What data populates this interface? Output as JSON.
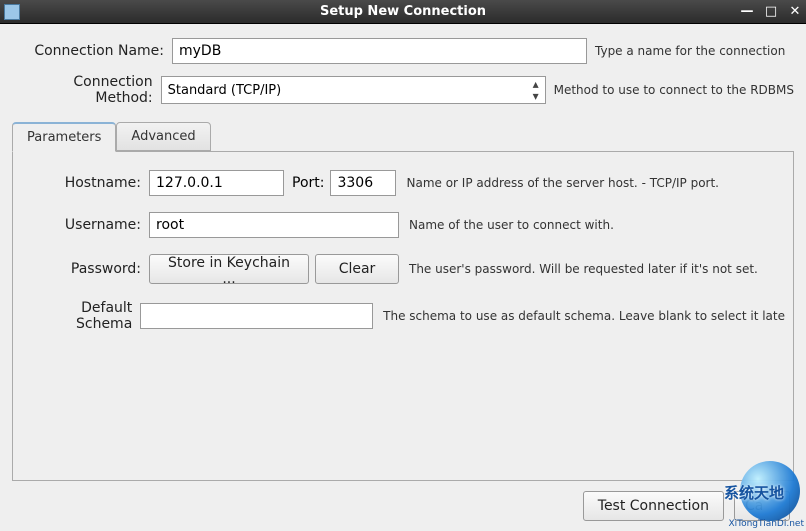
{
  "window": {
    "title": "Setup New Connection"
  },
  "connection_name": {
    "label": "Connection Name:",
    "value": "myDB",
    "hint": "Type a name for the connection"
  },
  "connection_method": {
    "label": "Connection Method:",
    "value": "Standard (TCP/IP)",
    "hint": "Method to use to connect to the RDBMS"
  },
  "tabs": {
    "parameters": "Parameters",
    "advanced": "Advanced"
  },
  "params": {
    "hostname": {
      "label": "Hostname:",
      "value": "127.0.0.1"
    },
    "port": {
      "label": "Port:",
      "value": "3306"
    },
    "host_desc": "Name or IP address of the server host. - TCP/IP port.",
    "username": {
      "label": "Username:",
      "value": "root",
      "desc": "Name of the user to connect with."
    },
    "password": {
      "label": "Password:",
      "store": "Store in Keychain ...",
      "clear": "Clear",
      "desc": "The user's password. Will be requested later if it's not set."
    },
    "schema": {
      "label": "Default Schema",
      "value": "",
      "desc": "The schema to use as default schema. Leave blank to select it late"
    }
  },
  "buttons": {
    "test": "Test Connection",
    "cancel": "Ca"
  },
  "watermark": {
    "main": "系统天地",
    "url": "XiTongTianDi.net"
  }
}
